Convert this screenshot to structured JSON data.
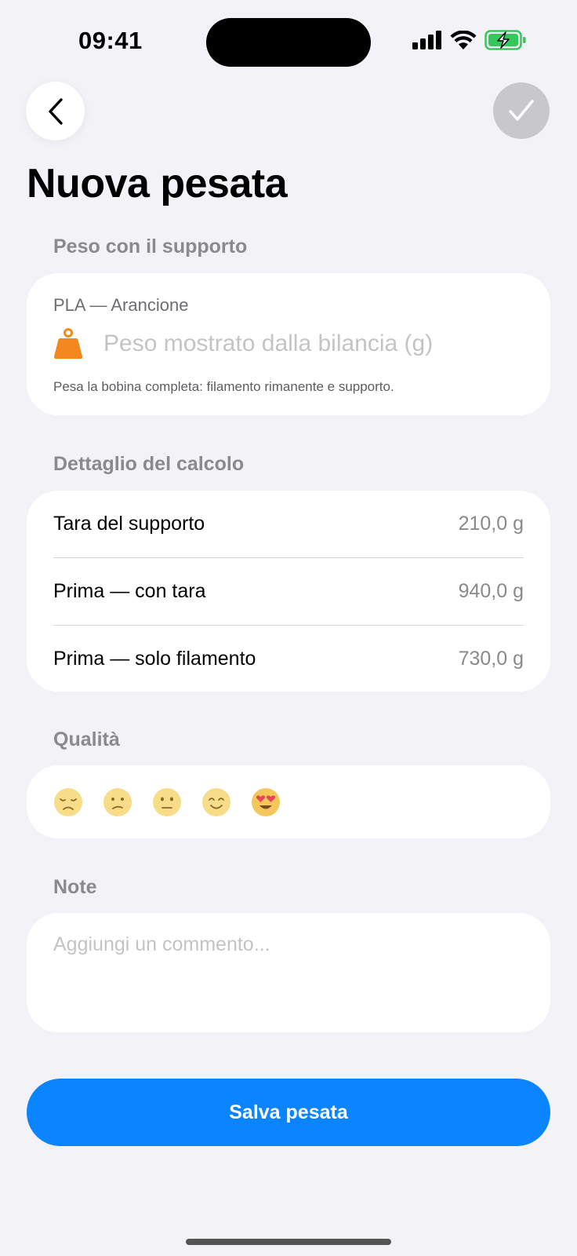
{
  "status_bar": {
    "time": "09:41"
  },
  "colors": {
    "accent": "#0a84ff",
    "weight_icon": "#f5871f",
    "background": "#f2f2f7",
    "done_disabled": "#c7c7cc",
    "battery": "#34c759"
  },
  "nav": {
    "back_icon": "chevron-left-icon",
    "done_icon": "checkmark-icon"
  },
  "page": {
    "title": "Nuova pesata"
  },
  "weight_section": {
    "label": "Peso con il supporto",
    "spool_name": "PLA — Arancione",
    "input_placeholder": "Peso mostrato dalla bilancia (g)",
    "input_value": "",
    "hint": "Pesa la bobina completa: filamento rimanente e supporto."
  },
  "calc_section": {
    "label": "Dettaglio del calcolo",
    "rows": [
      {
        "label": "Tara del supporto",
        "value": "210,0 g"
      },
      {
        "label": "Prima — con tara",
        "value": "940,0 g"
      },
      {
        "label": "Prima — solo filamento",
        "value": "730,0 g"
      }
    ]
  },
  "quality_section": {
    "label": "Qualità",
    "options": [
      "disappointed-face-icon",
      "confused-face-icon",
      "neutral-face-icon",
      "smiling-face-icon",
      "heart-eyes-face-icon"
    ]
  },
  "notes_section": {
    "label": "Note",
    "placeholder": "Aggiungi un commento...",
    "value": ""
  },
  "save_button": {
    "label": "Salva pesata"
  }
}
